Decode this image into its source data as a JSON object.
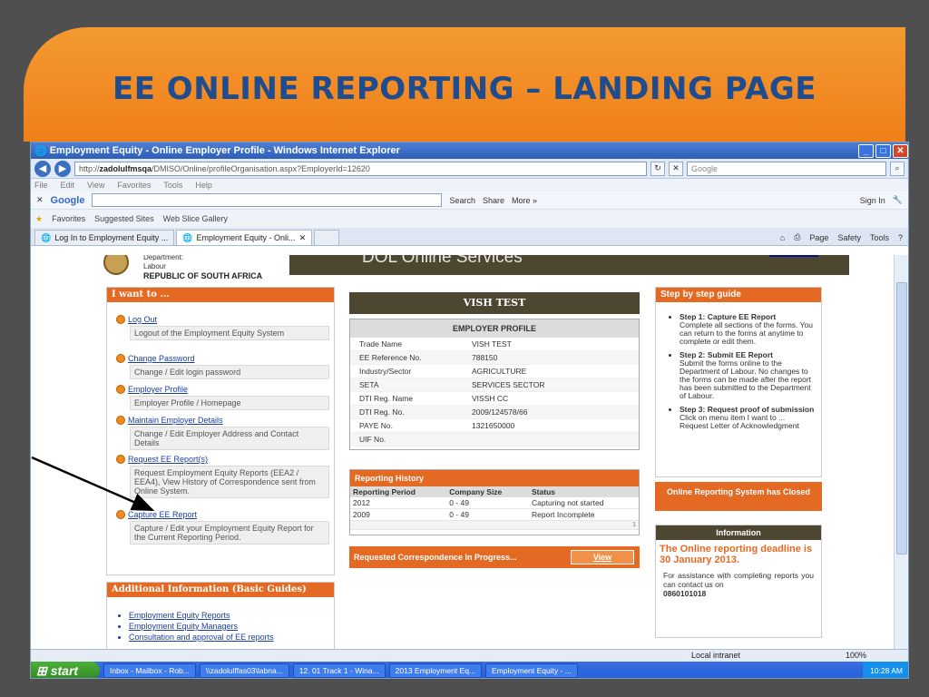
{
  "slide": {
    "title": "EE ONLINE REPORTING – LANDING PAGE"
  },
  "browser": {
    "window_title": "Employment Equity - Online Employer Profile - Windows Internet Explorer",
    "address_prefix": "http://",
    "address_host": "zadolulfmsqa",
    "address_path": "/DMISO/Online/profileOrganisation.aspx?EmployerId=12620",
    "search_placeholder": "Google",
    "menu": [
      "File",
      "Edit",
      "View",
      "Favorites",
      "Tools",
      "Help"
    ],
    "google_label": "Google",
    "google_search": "Search",
    "google_share": "Share",
    "google_more": "More »",
    "google_signin": "Sign In",
    "favorites_label": "Favorites",
    "suggested_sites": "Suggested Sites",
    "web_slice": "Web Slice Gallery",
    "tabs": [
      "Log In to Employment Equity ...",
      "Employment Equity - Onli..."
    ],
    "tab_tools": [
      "Page",
      "Safety",
      "Tools"
    ],
    "status_zone": "Local intranet",
    "zoom": "100%"
  },
  "header": {
    "dept_line1": "Department:",
    "dept_line2": "Labour",
    "dept_line3": "REPUBLIC OF SOUTH AFRICA",
    "service_title": "DOL Online Services"
  },
  "iwant": {
    "title": "I want to ...",
    "items": [
      {
        "link": "Log Out",
        "desc": "Logout of the Employment Equity System"
      },
      {
        "link": "Change Password",
        "desc": "Change / Edit login password"
      },
      {
        "link": "Employer Profile",
        "desc": "Employer Profile / Homepage"
      },
      {
        "link": "Maintain Employer Details",
        "desc": "Change / Edit Employer Address and Contact Details"
      },
      {
        "link": "Request EE Report(s)",
        "desc": "Request Employment Equity Reports (EEA2 / EEA4), View History of Correspondence sent from Online System."
      },
      {
        "link": "Capture EE Report",
        "desc": "Capture / Edit your Employment Equity Report for the Current Reporting Period."
      }
    ]
  },
  "additional": {
    "title": "Additional Information (Basic Guides)",
    "links": [
      "Employment Equity Reports",
      "Employment Equity Managers",
      "Consultation and approval of EE reports"
    ]
  },
  "employer": {
    "name_banner": "VISH TEST",
    "profile_title": "EMPLOYER PROFILE",
    "rows": [
      {
        "k": "Trade Name",
        "v": "VISH TEST"
      },
      {
        "k": "EE Reference No.",
        "v": "788150"
      },
      {
        "k": "Industry/Sector",
        "v": "AGRICULTURE"
      },
      {
        "k": "SETA",
        "v": "SERVICES SECTOR"
      },
      {
        "k": "DTI Reg. Name",
        "v": "VISSH CC"
      },
      {
        "k": "DTI Reg. No.",
        "v": "2009/124578/66"
      },
      {
        "k": "PAYE No.",
        "v": "1321650000"
      },
      {
        "k": "UIF No.",
        "v": ""
      }
    ]
  },
  "history": {
    "title": "Reporting History",
    "columns": [
      "Reporting Period",
      "Company Size",
      "Status"
    ],
    "rows": [
      [
        "2012",
        "0 - 49",
        "Capturing not started"
      ],
      [
        "2009",
        "0 - 49",
        "Report Incomplete"
      ]
    ],
    "page": "1"
  },
  "correspondence": {
    "title": "Requested Correspondence In Progress...",
    "view": "View"
  },
  "guide": {
    "title": "Step by step guide",
    "steps": [
      {
        "h": "Step 1: Capture EE Report",
        "t": "Complete all sections of the forms. You can return to the forms at anytime to complete or edit them."
      },
      {
        "h": "Step 2: Submit EE Report",
        "t": "Submit the forms online to the Department of Labour. No changes to the forms can be made after the report has been submitted to the Department of Labour."
      },
      {
        "h": "Step 3: Request proof of submission",
        "t": "Click on menu item I want to ... Request Letter of Acknowledgment"
      }
    ]
  },
  "closed": {
    "text": "Online Reporting System has Closed"
  },
  "information": {
    "title": "Information",
    "deadline": "The Online reporting deadline is 30 January 2013.",
    "assist": "For assistance with completing reports you can contact us on",
    "phone": "0860101018"
  },
  "taskbar": {
    "start": "start",
    "items": [
      "Inbox - Mailbox - Rob...",
      "\\\\zadolulffas03\\labna...",
      "12. 01 Track 1 - Wina...",
      "2013 Employment Eq...",
      "Employment Equity - ..."
    ],
    "clock": "10:28 AM"
  }
}
